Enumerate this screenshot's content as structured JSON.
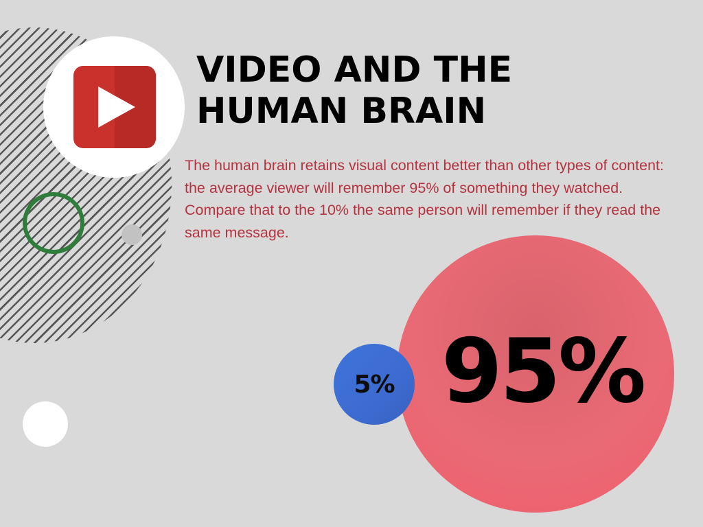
{
  "title": {
    "line1": "VIDEO AND THE",
    "line2": "HUMAN BRAIN"
  },
  "description": "The human brain retains visual content better than other types of content: the average viewer will remember 95% of something they watched. Compare that to the 10% the same person will remember if they read the same message.",
  "stats": {
    "large_label": "95%",
    "small_label": "5%"
  },
  "icons": {
    "logo": "video-play-icon"
  },
  "colors": {
    "background": "#d9d9d9",
    "accent_text": "#b5333f",
    "large_circle": "#e96a75",
    "small_circle": "#3d6bd0",
    "ring": "#2e7d3a",
    "play_button": "#c8312c"
  }
}
